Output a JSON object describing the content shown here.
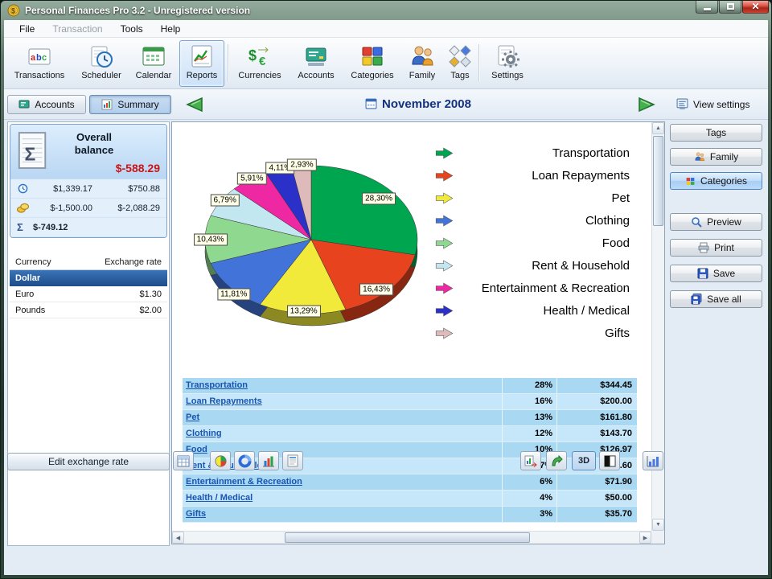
{
  "window": {
    "title": "Personal Finances Pro 3.2 - Unregistered version"
  },
  "menu": {
    "items": [
      {
        "label": "File",
        "enabled": true
      },
      {
        "label": "Transaction",
        "enabled": false
      },
      {
        "label": "Tools",
        "enabled": true
      },
      {
        "label": "Help",
        "enabled": true
      }
    ]
  },
  "toolbar": {
    "items": [
      {
        "label": "Transactions",
        "selected": false
      },
      {
        "label": "Scheduler",
        "selected": false
      },
      {
        "label": "Calendar",
        "selected": false
      },
      {
        "label": "Reports",
        "selected": true
      },
      {
        "label": "Currencies",
        "selected": false
      },
      {
        "label": "Accounts",
        "selected": false
      },
      {
        "label": "Categories",
        "selected": false
      },
      {
        "label": "Family",
        "selected": false
      },
      {
        "label": "Tags",
        "selected": false
      },
      {
        "label": "Settings",
        "selected": false
      }
    ]
  },
  "subtoolbar": {
    "accounts_label": "Accounts",
    "summary_label": "Summary",
    "period_title": "November 2008",
    "view_settings_label": "View settings"
  },
  "balance_panel": {
    "title": "Overall balance",
    "total": "$-588.29",
    "rows": [
      {
        "left": "$1,339.17",
        "right": "$750.88"
      },
      {
        "left": "$-1,500.00",
        "right": "$-2,088.29"
      }
    ],
    "sigma_symbol": "Σ",
    "sigma_total": "$-749.12"
  },
  "currency_panel": {
    "headers": [
      "Currency",
      "Exchange rate"
    ],
    "rows": [
      {
        "name": "Dollar",
        "rate": "",
        "selected": true
      },
      {
        "name": "Euro",
        "rate": "$1.30",
        "selected": false
      },
      {
        "name": "Pounds",
        "rate": "$2.00",
        "selected": false
      }
    ],
    "edit_button_label": "Edit exchange rate"
  },
  "chart_data": {
    "type": "pie",
    "style": "3d",
    "title": "November 2008",
    "legend_position": "right",
    "categories": [
      "Transportation",
      "Loan Repayments",
      "Pet",
      "Clothing",
      "Food",
      "Rent & Household",
      "Entertainment & Recreation",
      "Health / Medical",
      "Gifts"
    ],
    "values": [
      28.3,
      16.43,
      13.29,
      11.81,
      10.43,
      6.79,
      5.91,
      4.11,
      2.93
    ],
    "labels": [
      "28,30%",
      "16,43%",
      "13,29%",
      "11,81%",
      "10,43%",
      "6,79%",
      "5,91%",
      "4,11%",
      "2,93%"
    ],
    "colors": [
      "#00a550",
      "#e8431f",
      "#f2ea3a",
      "#4273d9",
      "#8fd88f",
      "#c2e7f0",
      "#ee28a2",
      "#2b30c8",
      "#debaba"
    ]
  },
  "report_table": {
    "rows": [
      {
        "category": "Transportation",
        "percent": "28%",
        "amount": "$344.45"
      },
      {
        "category": "Loan Repayments",
        "percent": "16%",
        "amount": "$200.00"
      },
      {
        "category": "Pet",
        "percent": "13%",
        "amount": "$161.80"
      },
      {
        "category": "Clothing",
        "percent": "12%",
        "amount": "$143.70"
      },
      {
        "category": "Food",
        "percent": "10%",
        "amount": "$126.97"
      },
      {
        "category": "Rent & Household",
        "percent": "7%",
        "amount": "$82.60"
      },
      {
        "category": "Entertainment & Recreation",
        "percent": "6%",
        "amount": "$71.90"
      },
      {
        "category": "Health / Medical",
        "percent": "4%",
        "amount": "$50.00"
      },
      {
        "category": "Gifts",
        "percent": "3%",
        "amount": "$35.70"
      }
    ]
  },
  "right_panel": {
    "view_buttons": [
      {
        "label": "Tags",
        "selected": false
      },
      {
        "label": "Family",
        "selected": false
      },
      {
        "label": "Categories",
        "selected": true
      }
    ],
    "action_buttons": [
      {
        "label": "Preview"
      },
      {
        "label": "Print"
      },
      {
        "label": "Save"
      },
      {
        "label": "Save all"
      }
    ]
  },
  "footer": {
    "threed_label": "3D"
  }
}
